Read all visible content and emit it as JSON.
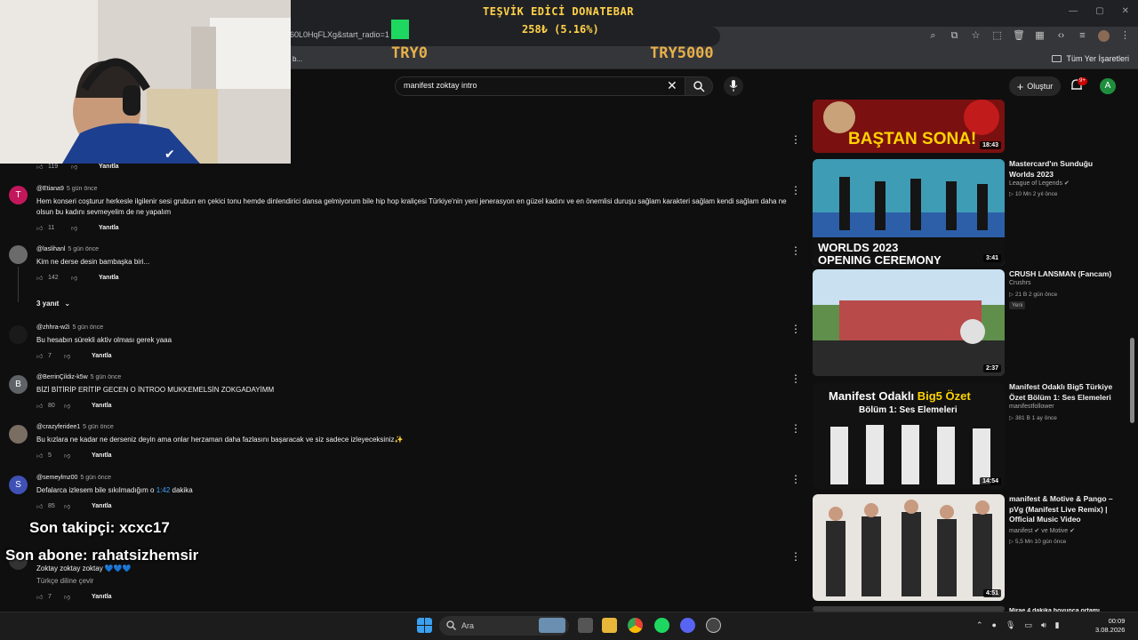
{
  "browser": {
    "url_fragment": "60L0HqFLXg&start_radio=1",
    "bookmark_left": "b...",
    "bookmarks_all_label": "Tüm Yer İşaretleri"
  },
  "donation": {
    "title": "TEŞVİK EDİCİ DONATEBAR",
    "progress_text": "258₺ (5.16%)",
    "progress_fraction": 0.0516,
    "min_label": "TRY0",
    "max_label": "TRY5000",
    "bar_color": "#1ed760"
  },
  "youtube": {
    "search_query": "manifest zoktay intro",
    "create_label": "Oluştur",
    "notif_count": "9+",
    "user_initial": "A"
  },
  "comments": [
    {
      "likes": "119",
      "reply_label": "Yanıtla"
    },
    {
      "avatar_letter": "T",
      "avatar_color": "#c2185b",
      "author": "@Etiana9",
      "time": "5 gün önce",
      "text": "Hem konseri coşturur herkesle ilgilenir sesi grubun en çekici tonu hemde dinlendirici dansa gelmiyorum bile hip hop kraliçesi Türkiye'nin yeni jenerasyon en güzel kadını ve en önemlisi duruşu sağlam karakteri sağlam kendi sağlam daha ne olsun bu kadını sevmeyelim de ne yapalım",
      "likes": "11",
      "reply_label": "Yanıtla"
    },
    {
      "avatar_letter": "",
      "avatar_color": "#6b6b6b",
      "author": "@laslihanl",
      "time": "5 gün önce",
      "text": "Kim ne derse desin bambaşka biri...",
      "likes": "142",
      "reply_label": "Yanıtla"
    },
    {
      "avatar_letter": "",
      "avatar_color": "#1a1a1a",
      "author": "@zhhra-w2i",
      "time": "5 gün önce",
      "text": "Bu hesabın sürekli aktiv olması gerek yaaa",
      "likes": "7",
      "reply_label": "Yanıtla"
    },
    {
      "avatar_letter": "B",
      "avatar_color": "#5f6368",
      "author": "@BerrinÇildiz-k5w",
      "time": "5 gün önce",
      "text": "BİZİ BİTİRİP ERİTİP GECEN O İNTROO MUKKEMELSİN ZOKGADAYİMM",
      "likes": "80",
      "reply_label": "Yanıtla"
    },
    {
      "avatar_letter": "",
      "avatar_color": "#7a6e63",
      "author": "@crazyferidee1",
      "time": "5 gün önce",
      "text": "Bu kızlara ne kadar ne derseniz deyin ama onlar herzaman daha fazlasını başaracak ve siz sadece izleyeceksiniz✨",
      "likes": "5",
      "reply_label": "Yanıtla"
    },
    {
      "avatar_letter": "S",
      "avatar_color": "#3f51b5",
      "author": "@semeylmz00",
      "time": "5 gün önce",
      "text_before": "Defalarca izlesem bile sıkılmadığım o ",
      "timestamp": "1:42",
      "text_after": " dakika",
      "likes": "85",
      "reply_label": "Yanıtla"
    },
    {
      "avatar_letter": "",
      "avatar_color": "#333333",
      "text": "Zoktay zoktay zoktay 💙💙💙",
      "translate_label": "Türkçe diline çevir",
      "likes": "7",
      "reply_label": "Yanıtla"
    }
  ],
  "replies_toggle": "3 yanıt",
  "overlay": {
    "last_follower": "Son takipçi: xcxc17",
    "last_sub": "Son abone: rahatsizhemsir"
  },
  "sidebar_videos": [
    {
      "thumb_text": "BAŞTAN SONA!",
      "duration": "18:43",
      "thumb_color": "#b01e1e"
    },
    {
      "title": "Mastercard'ın Sunduğu Worlds 2023",
      "channel": "League of Legends",
      "verified": true,
      "views": "10 Mn",
      "age": "2 yıl önce",
      "thumb_text": "WORLDS 2023 OPENING CEREMONY",
      "duration": "3:41",
      "thumb_color": "#4fb3c9"
    },
    {
      "title": "CRUSH LANSMAN (Fancam)",
      "channel": "Crushrs",
      "views": "21 B",
      "age": "2 gün önce",
      "badge": "Yeni",
      "duration": "2:37",
      "thumb_color": "#4b6b3a"
    },
    {
      "title": "Manifest Odaklı Big5 Türkiye Özet Bölüm 1: Ses Elemeleri",
      "channel": "manifestfollower",
      "views": "381 B",
      "age": "1 ay önce",
      "thumb_line1_a": "Manifest Odaklı",
      "thumb_line1_b": "Big5 Özet",
      "thumb_line2": "Bölüm 1: Ses Elemeleri",
      "duration": "14:54",
      "thumb_color": "#111111"
    },
    {
      "title": "manifest & Motive & Pango – pVg (Manifest Live Remix) | Official Music Video",
      "channel": "manifest",
      "channel_extra": "ve Motive",
      "views": "5,5 Mn",
      "age": "10 gün önce",
      "duration": "4:51",
      "thumb_color": "#e8e4df"
    },
    {
      "title": "Mirae 4 dakika boyunca ortamı",
      "thumb_color": "#3a3a3a"
    }
  ],
  "taskbar": {
    "search_label": "Ara",
    "time": "00:09",
    "date": "3.08.2026"
  }
}
